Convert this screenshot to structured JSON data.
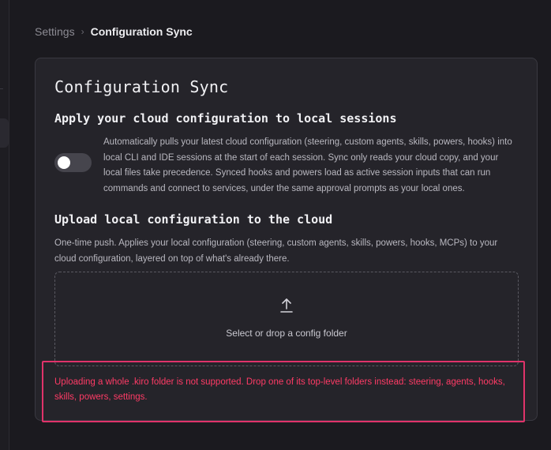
{
  "breadcrumb": {
    "parent": "Settings",
    "separator": "›",
    "current": "Configuration Sync"
  },
  "card": {
    "title": "Configuration Sync",
    "sync_section": {
      "title": "Apply your cloud configuration to local sessions",
      "toggle_state": "off",
      "description": "Automatically pulls your latest cloud configuration (steering, custom agents, skills, powers, hooks) into local CLI and IDE sessions at the start of each session. Sync only reads your cloud copy, and your local files take precedence. Synced hooks and powers load as active session inputs that can run commands and connect to services, under the same approval prompts as your local ones."
    },
    "upload_section": {
      "title": "Upload local configuration to the cloud",
      "description": "One-time push. Applies your local configuration (steering, custom agents, skills, powers, hooks, MCPs) to your cloud configuration, layered on top of what's already there.",
      "dropzone_label": "Select or drop a config folder",
      "icon": "upload-icon"
    },
    "error": {
      "message": "Uploading a whole .kiro folder is not supported. Drop one of its top-level folders instead: steering, agents, hooks, skills, powers, settings.",
      "color": "#ff3b66"
    }
  },
  "colors": {
    "background": "#1b1a1f",
    "card": "#25242a",
    "error_border": "#e0336a"
  }
}
